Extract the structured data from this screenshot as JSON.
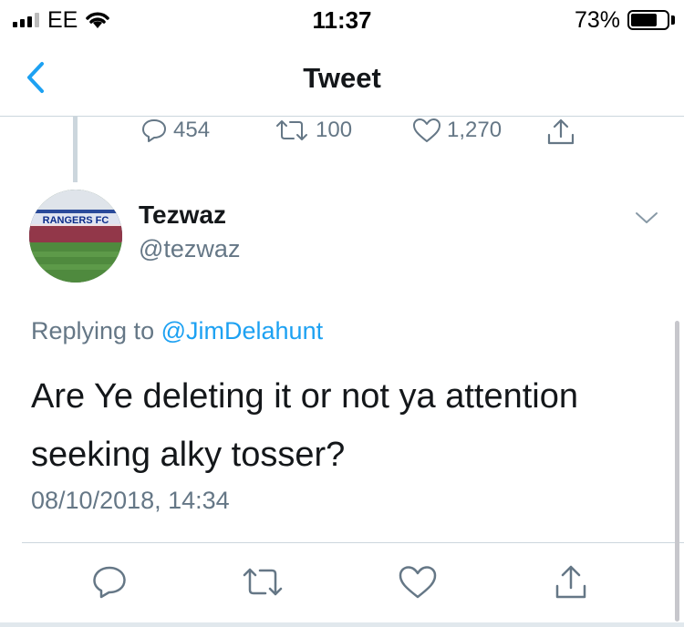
{
  "status_bar": {
    "carrier": "EE",
    "time": "11:37",
    "battery_percent": "73%",
    "battery_level": 0.73
  },
  "nav": {
    "title": "Tweet",
    "back_icon": "chevron-left-icon"
  },
  "parent_tweet": {
    "replies": "454",
    "retweets": "100",
    "likes": "1,270"
  },
  "tweet": {
    "author": {
      "display_name": "Tezwaz",
      "handle": "@tezwaz",
      "avatar_banner": "RANGERS FC"
    },
    "replying_prefix": "Replying to",
    "replying_to": "@JimDelahunt",
    "text": "Are Ye deleting it or not ya attention seeking alky tosser?",
    "timestamp": "08/10/2018, 14:34"
  },
  "actions": [
    "reply-icon",
    "retweet-icon",
    "like-icon",
    "share-icon"
  ],
  "colors": {
    "accent": "#1da1f2",
    "secondary_text": "#657786",
    "primary_text": "#14171a",
    "divider": "#ccd6dd"
  }
}
